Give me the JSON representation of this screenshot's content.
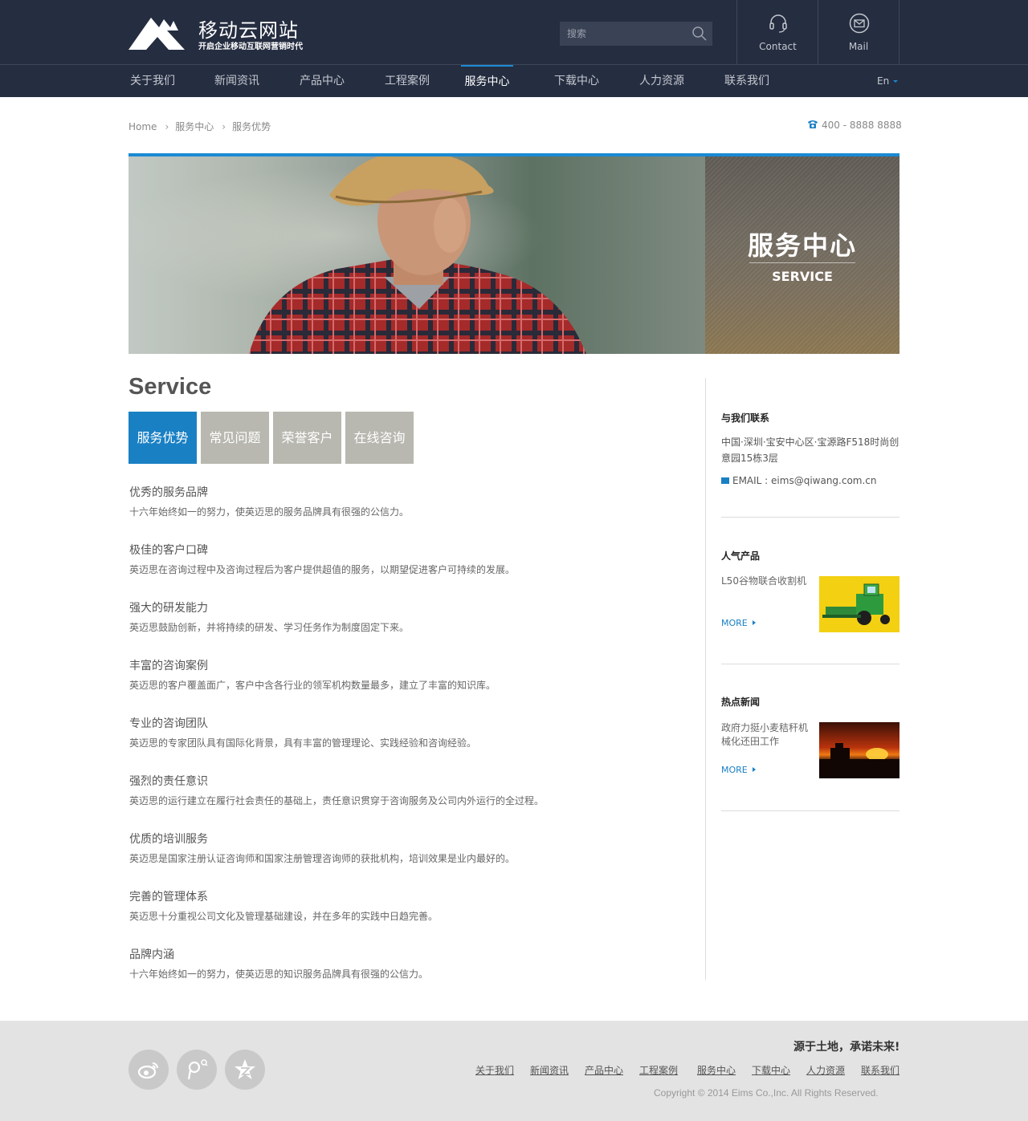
{
  "header": {
    "site_title": "移动云网站",
    "site_subtitle": "开启企业移动互联网营销时代",
    "search_placeholder": "搜索",
    "contact_label": "Contact",
    "mail_label": "Mail"
  },
  "nav": {
    "items": [
      {
        "label": "关于我们"
      },
      {
        "label": "新闻资讯"
      },
      {
        "label": "产品中心"
      },
      {
        "label": "工程案例"
      },
      {
        "label": "服务中心",
        "active": true
      },
      {
        "label": "下载中心"
      },
      {
        "label": "人力资源"
      },
      {
        "label": "联系我们"
      }
    ],
    "lang": "En"
  },
  "breadcrumb": {
    "home": "Home",
    "level1": "服务中心",
    "level2": "服务优势"
  },
  "phone": "400 - 8888 8888",
  "banner": {
    "title_cn": "服务中心",
    "title_en": "SERVICE"
  },
  "main": {
    "title": "Service",
    "tabs": [
      {
        "label": "服务优势",
        "active": true
      },
      {
        "label": "常见问题"
      },
      {
        "label": "荣誉客户"
      },
      {
        "label": "在线咨询"
      }
    ],
    "items": [
      {
        "title": "优秀的服务品牌",
        "desc": "十六年始终如一的努力，使英迈思的服务品牌具有很强的公信力。"
      },
      {
        "title": "极佳的客户口碑",
        "desc": "英迈思在咨询过程中及咨询过程后为客户提供超值的服务，以期望促进客户可持续的发展。"
      },
      {
        "title": "强大的研发能力",
        "desc": "英迈思鼓励创新，并将持续的研发、学习任务作为制度固定下来。"
      },
      {
        "title": "丰富的咨询案例",
        "desc": "英迈思的客户覆盖面广，客户中含各行业的领军机构数量最多，建立了丰富的知识库。"
      },
      {
        "title": "专业的咨询团队",
        "desc": "英迈思的专家团队具有国际化背景，具有丰富的管理理论、实践经验和咨询经验。"
      },
      {
        "title": "强烈的责任意识",
        "desc": "英迈思的运行建立在履行社会责任的基础上，责任意识贯穿于咨询服务及公司内外运行的全过程。"
      },
      {
        "title": "优质的培训服务",
        "desc": "英迈思是国家注册认证咨询师和国家注册管理咨询师的获批机构，培训效果是业内最好的。"
      },
      {
        "title": "完善的管理体系",
        "desc": "英迈思十分重视公司文化及管理基础建设，并在多年的实践中日趋完善。"
      },
      {
        "title": "品牌内涵",
        "desc": "十六年始终如一的努力，使英迈思的知识服务品牌具有很强的公信力。"
      }
    ]
  },
  "sidebar": {
    "contact": {
      "heading": "与我们联系",
      "address": "中国·深圳·宝安中心区·宝源路F518时尚创意园15栋3层",
      "email": "EMAIL : eims@qiwang.com.cn"
    },
    "products": {
      "heading": "人气产品",
      "name": "L50谷物联合收割机",
      "more": "MORE"
    },
    "news": {
      "heading": "热点新闻",
      "title": "政府力挺小麦秸秆机械化还田工作",
      "more": "MORE"
    }
  },
  "footer": {
    "slogan": "源于土地，承诺未来!",
    "links": [
      "关于我们",
      "新闻资讯",
      "产品中心",
      "工程案例",
      "服务中心",
      "下载中心",
      "人力资源",
      "联系我们"
    ],
    "copyright": "Copyright © 2014  Eims Co.,Inc. All Rights Reserved."
  },
  "colors": {
    "header_bg": "#252d40",
    "accent": "#1a80c4",
    "tab_inactive": "#b8b8b0",
    "footer_bg": "#e3e3e3"
  },
  "icons": [
    "logo-mark",
    "search-icon",
    "headset-icon",
    "mail-icon",
    "phone-icon",
    "email-icon",
    "weibo-icon",
    "wechat-icon",
    "qzone-icon"
  ]
}
